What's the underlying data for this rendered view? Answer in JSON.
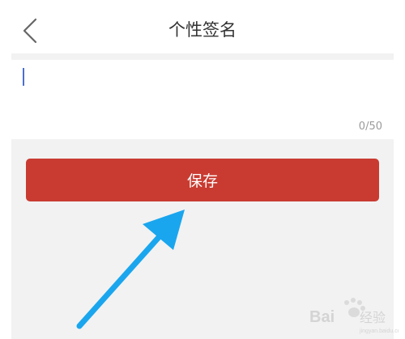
{
  "header": {
    "title": "个性签名",
    "back_icon": "chevron-left-icon"
  },
  "editor": {
    "value": "",
    "placeholder": "",
    "counter": "0/50"
  },
  "actions": {
    "save_label": "保存"
  },
  "annotation": {
    "arrow_icon": "arrow-up-right-icon",
    "arrow_color": "#1aa6ee"
  },
  "watermark": {
    "text": "Baidu 经验"
  },
  "colors": {
    "primary": "#c93b31",
    "background_grey": "#f2f2f2",
    "caret": "#4a6fd1"
  }
}
